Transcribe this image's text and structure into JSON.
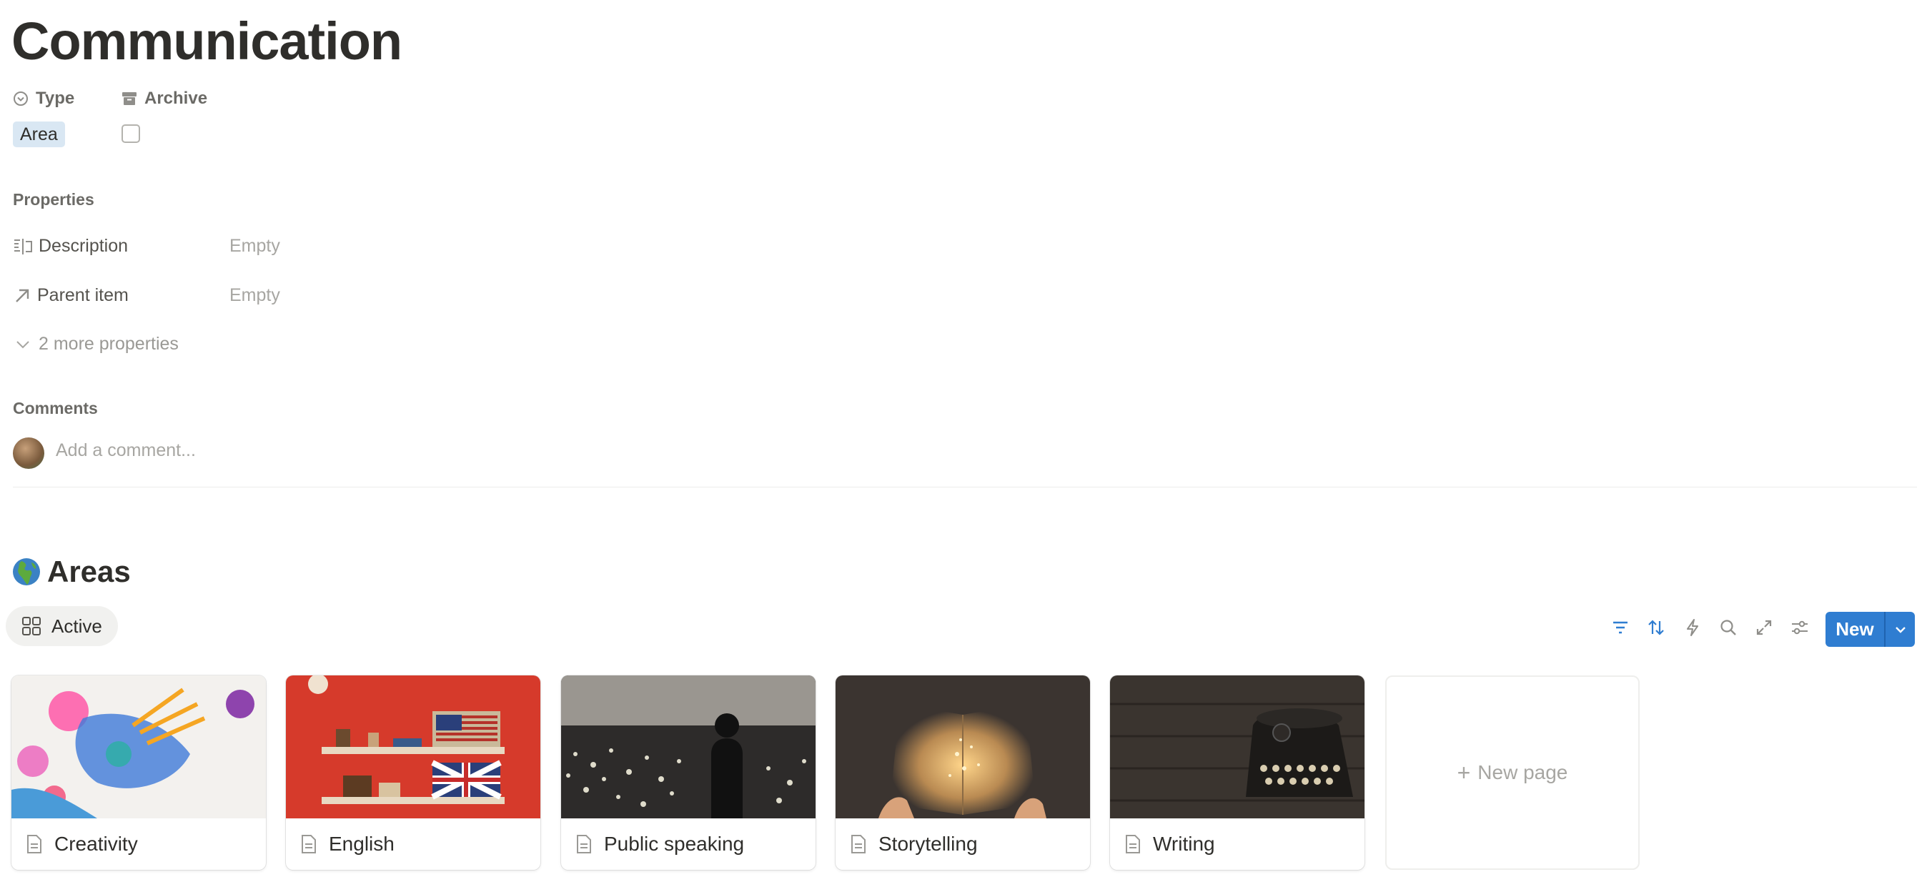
{
  "page": {
    "title": "Communication"
  },
  "header_props": {
    "type": {
      "label": "Type",
      "value": "Area",
      "icon": "select-circle-icon"
    },
    "archive": {
      "label": "Archive",
      "checked": false,
      "icon": "archive-box-icon"
    }
  },
  "properties": {
    "section_label": "Properties",
    "rows": [
      {
        "label": "Description",
        "value": "Empty",
        "icon": "text-lines-icon"
      },
      {
        "label": "Parent item",
        "value": "Empty",
        "icon": "arrow-up-right-icon"
      }
    ],
    "more_label": "2 more properties"
  },
  "comments": {
    "section_label": "Comments",
    "placeholder": "Add a comment..."
  },
  "areas": {
    "title": "Areas",
    "emoji": "globe-europe-africa-icon",
    "view_tab": "Active",
    "toolbar": {
      "icons": [
        "filter-icon",
        "sort-icon",
        "lightning-icon",
        "search-icon",
        "expand-icon",
        "settings-sliders-icon"
      ],
      "new_label": "New"
    },
    "cards": [
      {
        "title": "Creativity"
      },
      {
        "title": "English"
      },
      {
        "title": "Public speaking"
      },
      {
        "title": "Storytelling"
      },
      {
        "title": "Writing"
      }
    ],
    "new_page_label": "New page"
  },
  "colors": {
    "accent": "#2f7dd1",
    "tag_bg": "#d9e7f3",
    "text": "#37352f",
    "muted": "#a7a6a2"
  }
}
